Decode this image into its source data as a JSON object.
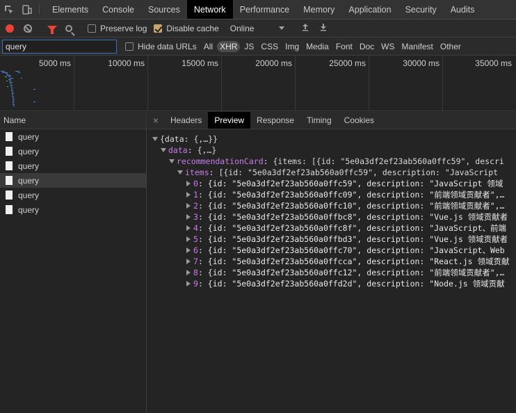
{
  "tabs": [
    "Elements",
    "Console",
    "Sources",
    "Network",
    "Performance",
    "Memory",
    "Application",
    "Security",
    "Audits"
  ],
  "active_tab": "Network",
  "toolbar": {
    "preserve_log": "Preserve log",
    "disable_cache": "Disable cache",
    "throttle": "Online"
  },
  "filter": {
    "value": "query",
    "hide_data_urls": "Hide data URLs",
    "types": [
      "All",
      "XHR",
      "JS",
      "CSS",
      "Img",
      "Media",
      "Font",
      "Doc",
      "WS",
      "Manifest",
      "Other"
    ],
    "active_type": "XHR"
  },
  "overview": {
    "ticks": [
      "5000 ms",
      "10000 ms",
      "15000 ms",
      "20000 ms",
      "25000 ms",
      "30000 ms",
      "35000 ms"
    ]
  },
  "requests": {
    "header": "Name",
    "items": [
      "query",
      "query",
      "query",
      "query",
      "query",
      "query"
    ],
    "selected_index": 3
  },
  "detail": {
    "tabs": [
      "Headers",
      "Preview",
      "Response",
      "Timing",
      "Cookies"
    ],
    "active_tab": "Preview",
    "root": "{data: {,…}}",
    "data_key": "data",
    "data_val": "{,…}",
    "card_key": "recommendationCard",
    "card_val": "{items: [{id: \"5e0a3df2ef23ab560a0ffc59\", descri",
    "items_key": "items",
    "items_val": "[{id: \"5e0a3df2ef23ab560a0ffc59\", description: \"JavaScript",
    "entries": [
      {
        "k": "0",
        "v": "{id: \"5e0a3df2ef23ab560a0ffc59\", description: \"JavaScript 领域"
      },
      {
        "k": "1",
        "v": "{id: \"5e0a3df2ef23ab560a0ffc09\", description: \"前端领域贡献者\",…"
      },
      {
        "k": "2",
        "v": "{id: \"5e0a3df2ef23ab560a0ffc10\", description: \"前端领域贡献者\",…"
      },
      {
        "k": "3",
        "v": "{id: \"5e0a3df2ef23ab560a0ffbc8\", description: \"Vue.js 领域贡献者"
      },
      {
        "k": "4",
        "v": "{id: \"5e0a3df2ef23ab560a0ffc8f\", description: \"JavaScript、前端"
      },
      {
        "k": "5",
        "v": "{id: \"5e0a3df2ef23ab560a0ffbd3\", description: \"Vue.js 领域贡献者"
      },
      {
        "k": "6",
        "v": "{id: \"5e0a3df2ef23ab560a0ffc70\", description: \"JavaScript、Web"
      },
      {
        "k": "7",
        "v": "{id: \"5e0a3df2ef23ab560a0ffcca\", description: \"React.js 领域贡献"
      },
      {
        "k": "8",
        "v": "{id: \"5e0a3df2ef23ab560a0ffc12\", description: \"前端领域贡献者\",…"
      },
      {
        "k": "9",
        "v": "{id: \"5e0a3df2ef23ab560a0ffd2d\", description: \"Node.js 领域贡献"
      }
    ]
  },
  "colors": {
    "record": "#ea4335",
    "filter_icon": "#ea4335",
    "json_key": "#c77de6",
    "active_tab_bg": "#000000"
  }
}
